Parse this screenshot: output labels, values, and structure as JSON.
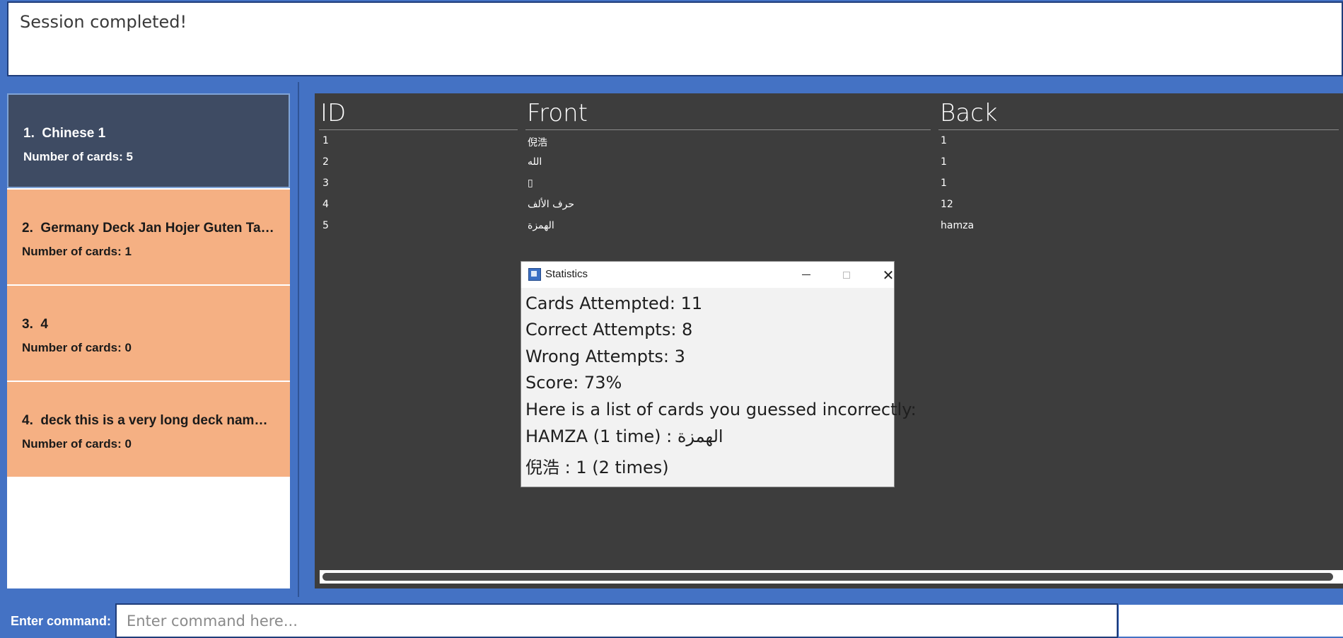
{
  "result": {
    "message": "Session completed!"
  },
  "decks": [
    {
      "index": "1.",
      "name": "Chinese 1",
      "count_label": "Number of cards: 5",
      "selected": true
    },
    {
      "index": "2.",
      "name": "Germany Deck Jan Hojer Guten Tag...",
      "count_label": "Number of cards: 1",
      "selected": false
    },
    {
      "index": "3.",
      "name": "4",
      "count_label": "Number of cards: 0",
      "selected": false
    },
    {
      "index": "4.",
      "name": "deck this is a very long deck name t...",
      "count_label": "Number of cards: 0",
      "selected": false
    }
  ],
  "table": {
    "headers": {
      "id": "ID",
      "front": "Front",
      "back": "Back"
    },
    "rows": [
      {
        "id": "1",
        "front": "倪浩",
        "back": "1"
      },
      {
        "id": "2",
        "front": "الله",
        "back": "1"
      },
      {
        "id": "3",
        "front": "▯",
        "back": "1"
      },
      {
        "id": "4",
        "front": "حرف الألف",
        "back": "12"
      },
      {
        "id": "5",
        "front": "الهمزة",
        "back": "hamza"
      }
    ]
  },
  "dialog": {
    "title": "Statistics",
    "lines": [
      "Cards Attempted: 11",
      "Correct Attempts: 8",
      "Wrong Attempts: 3",
      "Score: 73%",
      "Here is a list of cards you guessed incorrectly:",
      "HAMZA (1 time) : الهمزة",
      "倪浩 : 1 (2 times)"
    ],
    "score": 73
  },
  "command": {
    "label": "Enter command:",
    "placeholder": "Enter command here...",
    "value": ""
  },
  "colors": {
    "background_blue": "#4472c4",
    "selected_deck": "#3e4b63",
    "deck_card": "#f5b083",
    "table_bg": "#3d3d3d"
  },
  "icons": {
    "app_icon": "app-logo-icon",
    "minimize": "minimize-icon",
    "maximize": "maximize-icon",
    "close": "close-icon"
  }
}
